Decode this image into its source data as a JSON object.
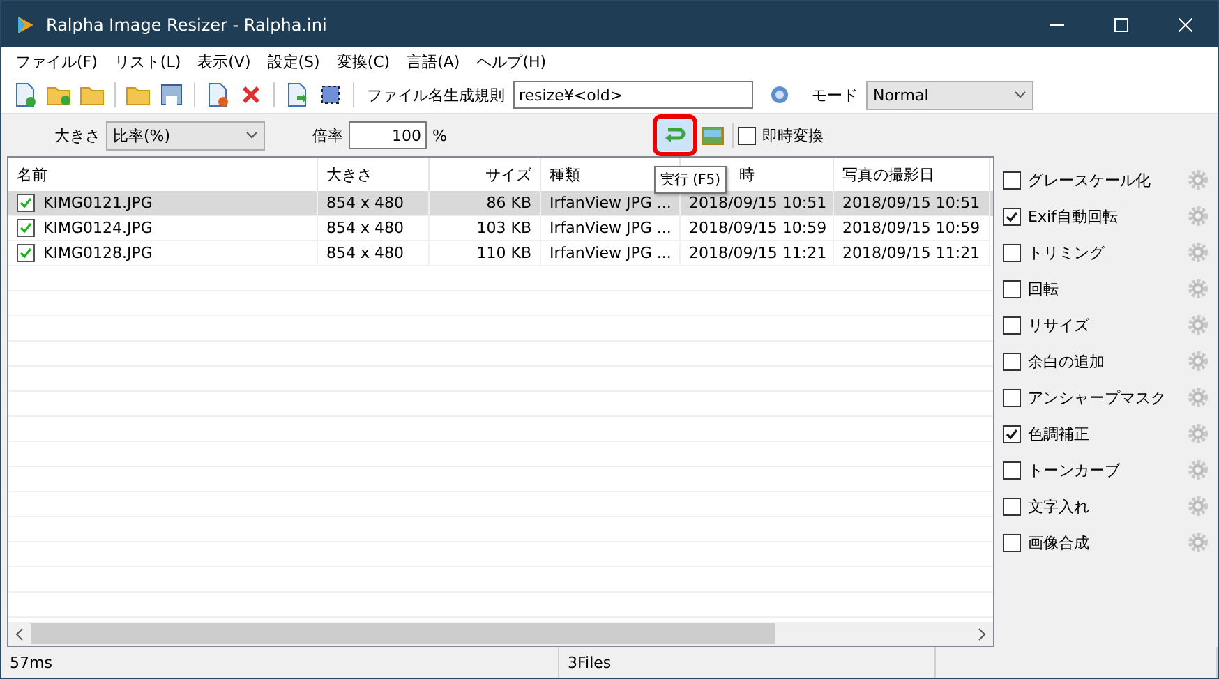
{
  "window": {
    "title": "Ralpha Image Resizer - Ralpha.ini"
  },
  "menu": [
    "ファイル(F)",
    "リスト(L)",
    "表示(V)",
    "設定(S)",
    "変換(C)",
    "言語(A)",
    "ヘルプ(H)"
  ],
  "toolbar": {
    "rule_label": "ファイル名生成規則",
    "rule_value": "resize¥<old>",
    "mode_label": "モード",
    "mode_value": "Normal"
  },
  "options": {
    "size_label": "大きさ",
    "size_mode": "比率(%)",
    "ratio_label": "倍率",
    "ratio_value": "100",
    "ratio_unit": "%",
    "instant": {
      "label": "即時変換",
      "checked": false
    }
  },
  "tooltip": "実行 (F5)",
  "table": {
    "columns": [
      {
        "label": "名前"
      },
      {
        "label": "大きさ"
      },
      {
        "label": "サイズ"
      },
      {
        "label": "種類"
      },
      {
        "label": "時"
      },
      {
        "label": "写真の撮影日"
      }
    ],
    "rows": [
      {
        "checked": true,
        "selected": true,
        "cells": [
          "KIMG0121.JPG",
          "854 x 480",
          "86 KB",
          "IrfanView JPG ...",
          "2018/09/15 10:51",
          "2018/09/15 10:51"
        ]
      },
      {
        "checked": true,
        "selected": false,
        "cells": [
          "KIMG0124.JPG",
          "854 x 480",
          "103 KB",
          "IrfanView JPG ...",
          "2018/09/15 10:59",
          "2018/09/15 10:59"
        ]
      },
      {
        "checked": true,
        "selected": false,
        "cells": [
          "KIMG0128.JPG",
          "854 x 480",
          "110 KB",
          "IrfanView JPG ...",
          "2018/09/15 11:21",
          "2018/09/15 11:21"
        ]
      }
    ]
  },
  "filters": [
    {
      "label": "グレースケール化",
      "checked": false
    },
    {
      "label": "Exif自動回転",
      "checked": true
    },
    {
      "label": "トリミング",
      "checked": false
    },
    {
      "label": "回転",
      "checked": false
    },
    {
      "label": "リサイズ",
      "checked": false
    },
    {
      "label": "余白の追加",
      "checked": false
    },
    {
      "label": "アンシャープマスク",
      "checked": false
    },
    {
      "label": "色調補正",
      "checked": true
    },
    {
      "label": "トーンカーブ",
      "checked": false
    },
    {
      "label": "文字入れ",
      "checked": false
    },
    {
      "label": "画像合成",
      "checked": false
    }
  ],
  "status_bar": [
    "57ms",
    "3Files"
  ]
}
